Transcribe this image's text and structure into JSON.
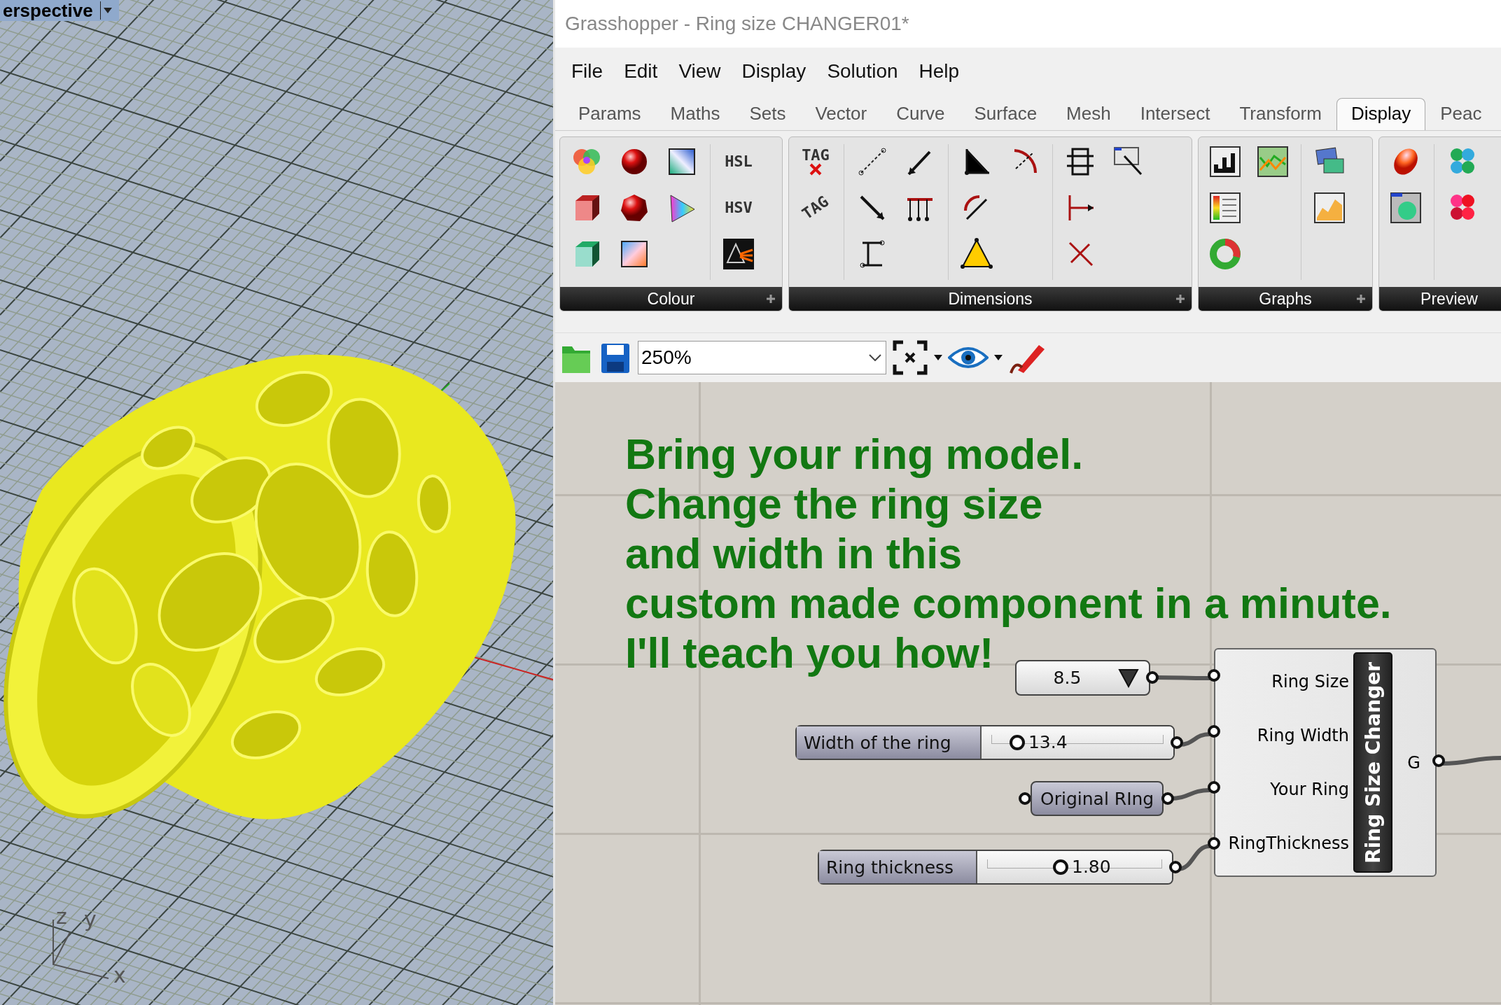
{
  "viewport": {
    "title": "erspective",
    "axis_labels": [
      "z",
      "y",
      "x"
    ]
  },
  "window": {
    "title": "Grasshopper - Ring size CHANGER01*"
  },
  "menu": [
    "File",
    "Edit",
    "View",
    "Display",
    "Solution",
    "Help"
  ],
  "tabs": [
    {
      "label": "Params",
      "selected": false
    },
    {
      "label": "Maths",
      "selected": false
    },
    {
      "label": "Sets",
      "selected": false
    },
    {
      "label": "Vector",
      "selected": false
    },
    {
      "label": "Curve",
      "selected": false
    },
    {
      "label": "Surface",
      "selected": false
    },
    {
      "label": "Mesh",
      "selected": false
    },
    {
      "label": "Intersect",
      "selected": false
    },
    {
      "label": "Transform",
      "selected": false
    },
    {
      "label": "Display",
      "selected": true
    },
    {
      "label": "Peac",
      "selected": false
    }
  ],
  "ribbon": {
    "groups": [
      {
        "kind": "colour",
        "title": "Colour",
        "icon_labels": [
          "HSL",
          "HSV"
        ]
      },
      {
        "kind": "dimensions",
        "title": "Dimensions",
        "icon_labels": [
          "TAG",
          "TAG"
        ]
      },
      {
        "kind": "graphs",
        "title": "Graphs"
      },
      {
        "kind": "preview",
        "title": "Preview"
      }
    ]
  },
  "toolbar": {
    "zoom": "250%"
  },
  "canvas": {
    "note_lines": [
      "Bring your ring model.",
      "Change the ring size",
      "and width in this",
      "custom made component in a minute.",
      "I'll teach you how!"
    ],
    "value_list": {
      "value": "8.5"
    },
    "sliders": [
      {
        "label": "Width of the ring",
        "value": "13.4",
        "level": 0.15
      },
      {
        "label": "Ring thickness",
        "value": "1.80",
        "level": 0.42
      }
    ],
    "param": {
      "label": "Original RIng"
    },
    "component": {
      "name": "Ring Size Changer",
      "inputs": [
        "Ring Size",
        "Ring Width",
        "Your Ring",
        "RingThickness"
      ],
      "outputs": [
        "G"
      ]
    }
  }
}
